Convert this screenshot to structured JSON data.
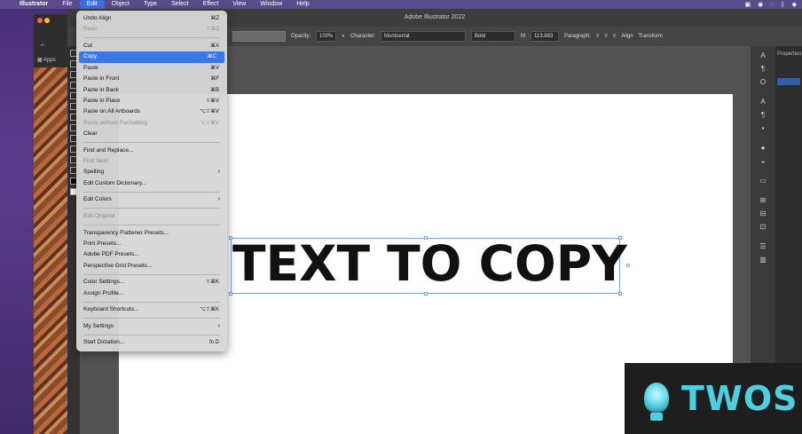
{
  "menubar": {
    "app": "Illustrator",
    "items": [
      "File",
      "Edit",
      "Object",
      "Type",
      "Select",
      "Effect",
      "View",
      "Window",
      "Help"
    ]
  },
  "window": {
    "title": "Adobe Illustrator 2022"
  },
  "browser": {
    "bookmark": "Apps"
  },
  "controlbar": {
    "opacity_label": "Opacity:",
    "opacity_value": "100%",
    "character_label": "Character:",
    "font": "Montserrat",
    "weight": "Bold",
    "size": "113.883",
    "paragraph_label": "Paragraph:",
    "align_label": "Align",
    "transform_label": "Transform"
  },
  "props_panel": {
    "title": "Properties"
  },
  "edit_menu": {
    "items": [
      {
        "label": "Undo Align",
        "shortcut": "⌘Z",
        "state": "normal"
      },
      {
        "label": "Redo",
        "shortcut": "⇧⌘Z",
        "state": "disabled"
      },
      {
        "sep": true
      },
      {
        "label": "Cut",
        "shortcut": "⌘X",
        "state": "normal"
      },
      {
        "label": "Copy",
        "shortcut": "⌘C",
        "state": "highlighted"
      },
      {
        "label": "Paste",
        "shortcut": "⌘V",
        "state": "normal"
      },
      {
        "label": "Paste in Front",
        "shortcut": "⌘F",
        "state": "normal"
      },
      {
        "label": "Paste in Back",
        "shortcut": "⌘B",
        "state": "normal"
      },
      {
        "label": "Paste in Place",
        "shortcut": "⇧⌘V",
        "state": "normal"
      },
      {
        "label": "Paste on All Artboards",
        "shortcut": "⌥⇧⌘V",
        "state": "normal"
      },
      {
        "label": "Paste without Formatting",
        "shortcut": "⌥⇧⌘V",
        "state": "disabled"
      },
      {
        "label": "Clear",
        "shortcut": "",
        "state": "normal"
      },
      {
        "sep": true
      },
      {
        "label": "Find and Replace...",
        "shortcut": "",
        "state": "normal"
      },
      {
        "label": "Find Next",
        "shortcut": "",
        "state": "disabled"
      },
      {
        "label": "Spelling",
        "shortcut": "",
        "state": "normal",
        "submenu": true
      },
      {
        "label": "Edit Custom Dictionary...",
        "shortcut": "",
        "state": "normal"
      },
      {
        "sep": true
      },
      {
        "label": "Edit Colors",
        "shortcut": "",
        "state": "normal",
        "submenu": true
      },
      {
        "sep": true
      },
      {
        "label": "Edit Original",
        "shortcut": "",
        "state": "disabled"
      },
      {
        "sep": true
      },
      {
        "label": "Transparency Flattener Presets...",
        "shortcut": "",
        "state": "normal"
      },
      {
        "label": "Print Presets...",
        "shortcut": "",
        "state": "normal"
      },
      {
        "label": "Adobe PDF Presets...",
        "shortcut": "",
        "state": "normal"
      },
      {
        "label": "Perspective Grid Presets...",
        "shortcut": "",
        "state": "normal"
      },
      {
        "sep": true
      },
      {
        "label": "Color Settings...",
        "shortcut": "⇧⌘K",
        "state": "normal"
      },
      {
        "label": "Assign Profile...",
        "shortcut": "",
        "state": "normal"
      },
      {
        "sep": true
      },
      {
        "label": "Keyboard Shortcuts...",
        "shortcut": "⌥⇧⌘K",
        "state": "normal"
      },
      {
        "sep": true
      },
      {
        "label": "My Settings",
        "shortcut": "",
        "state": "normal",
        "submenu": true
      },
      {
        "sep": true
      },
      {
        "label": "Start Dictation...",
        "shortcut": "fn D",
        "state": "normal"
      }
    ]
  },
  "artboard": {
    "text": "TEXT TO COPY"
  },
  "watermark": {
    "brand": "TWOS"
  },
  "colors": {
    "accent": "#3b78e6",
    "selection": "#7a9cf0",
    "brand": "#4ad0e0"
  }
}
